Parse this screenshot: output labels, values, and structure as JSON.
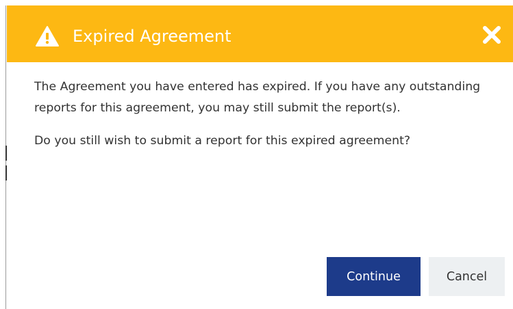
{
  "dialog": {
    "title": "Expired Agreement",
    "header_color": "#fdb813",
    "icons": {
      "title_icon": "warning-icon",
      "close_icon": "close-icon"
    },
    "messages": [
      "The Agreement you have entered has expired. If you have any outstanding reports for this agreement, you may still submit the report(s).",
      "Do you still wish to submit a report for this expired agreement?"
    ],
    "buttons": {
      "continue_label": "Continue",
      "continue_color": "#1d3b8a",
      "cancel_label": "Cancel",
      "cancel_color": "#edf0f2"
    }
  }
}
